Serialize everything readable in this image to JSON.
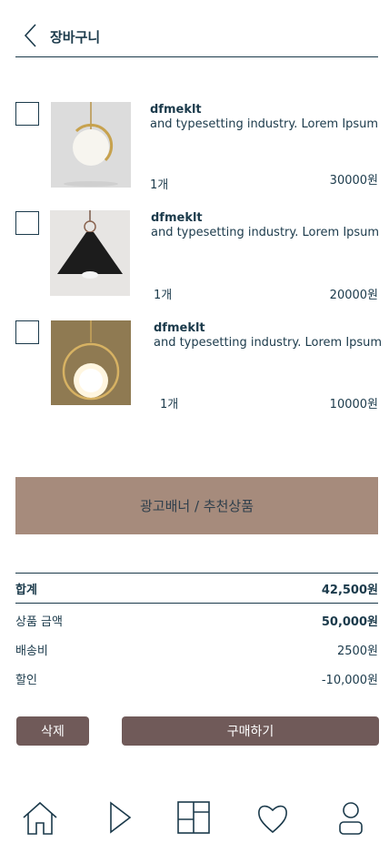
{
  "header": {
    "title": "장바구니",
    "back_icon": "chevron-left-icon"
  },
  "cart": {
    "items": [
      {
        "name": "dfmeklt",
        "description": "and typesetting industry. Lorem Ipsum",
        "quantity": "1개",
        "price": "30000원"
      },
      {
        "name": "dfmeklt",
        "description": "and typesetting industry. Lorem Ipsum",
        "quantity": "1개",
        "price": "20000원"
      },
      {
        "name": "dfmeklt",
        "description": "and typesetting industry. Lorem Ipsum",
        "quantity": "1개",
        "price": "10000원"
      }
    ]
  },
  "banner": {
    "label": "광고배너 / 추천상품"
  },
  "summary": {
    "total_label": "합계",
    "total_value": "42,500원",
    "goods_label": "상품 금액",
    "goods_value": "50,000원",
    "shipping_label": "배송비",
    "shipping_value": "2500원",
    "discount_label": "할인",
    "discount_value": "-10,000원"
  },
  "actions": {
    "delete_label": "삭제",
    "buy_label": "구매하기"
  },
  "bottom_nav": [
    "home-icon",
    "play-icon",
    "grid-icon",
    "heart-icon",
    "user-icon"
  ],
  "colors": {
    "primary_text": "#1b3a4b",
    "banner": "#a68b7c",
    "button": "#705a59"
  }
}
